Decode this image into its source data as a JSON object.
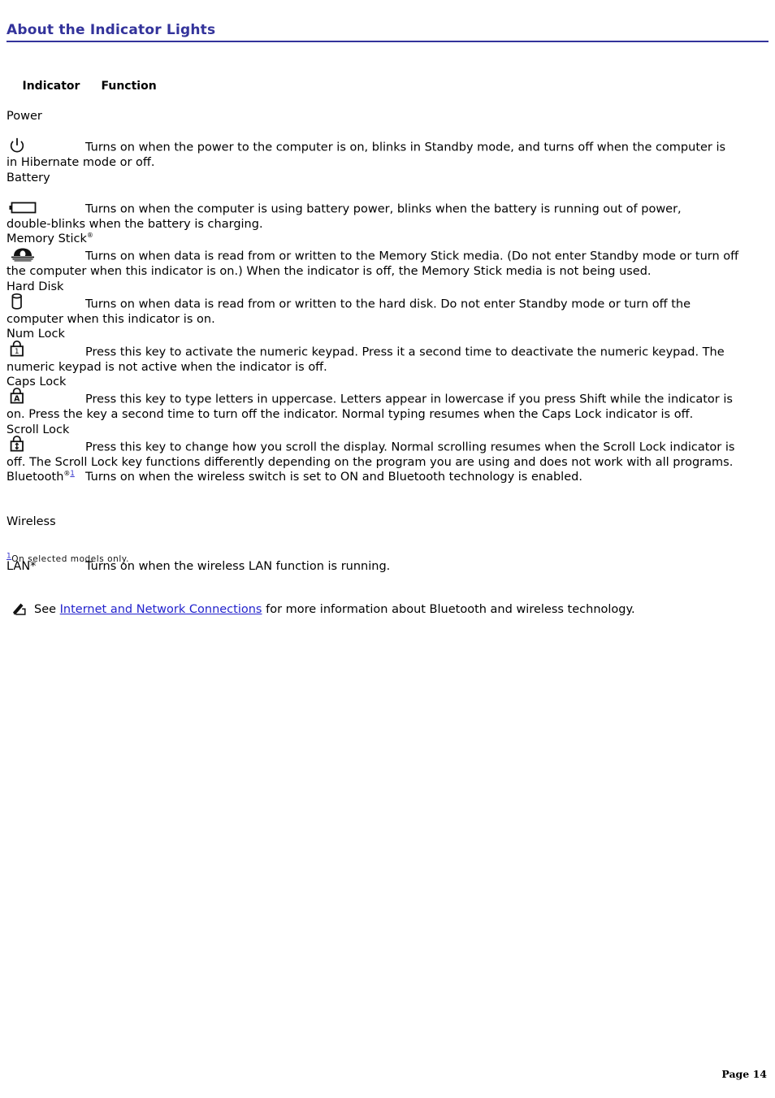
{
  "document": {
    "title": "About the Indicator Lights",
    "accent_color": "#33339B",
    "link_color": "#2222CC",
    "page_footer": "Page 14"
  },
  "table": {
    "headers": {
      "indicator": "Indicator",
      "function": "Function"
    },
    "rows": [
      {
        "label": "Power",
        "icon": "power-icon",
        "description_line1": "Turns on when the power to the computer is on, blinks in Standby mode, and turns off when the computer is",
        "description_line2": "in Hibernate mode or off."
      },
      {
        "label": "Battery",
        "icon": "battery-icon",
        "description_line1": "Turns on when the computer is using battery power, blinks when the battery is running out of power,",
        "description_line2": "double-blinks when the battery is charging."
      },
      {
        "label": "Memory Stick",
        "label_suffix": "®",
        "icon": "memory-stick-icon",
        "description_line1": "Turns on when data is read from or written to the Memory Stick media. (Do not enter Standby mode or turn off",
        "description_line2": "the computer when this indicator is on.) When the indicator is off, the Memory Stick media is not being used."
      },
      {
        "label": "Hard Disk",
        "icon": "hard-disk-icon",
        "description_line1": "Turns on when data is read from or written to the hard disk. Do not enter Standby mode or turn off the",
        "description_line2": "computer when this indicator is on."
      },
      {
        "label": "Num Lock",
        "icon": "num-lock-icon",
        "description_line1": "Press this key to activate the numeric keypad. Press it a second time to deactivate the numeric keypad. The",
        "description_line2": "numeric keypad is not active when the indicator is off."
      },
      {
        "label": "Caps Lock",
        "icon": "caps-lock-icon",
        "description_line1": "Press this key to type letters in uppercase. Letters appear in lowercase if you press Shift while the indicator is",
        "description_line2": "on. Press the key a second time to turn off the indicator. Normal typing resumes when the Caps Lock indicator is off."
      },
      {
        "label": "Scroll Lock",
        "icon": "scroll-lock-icon",
        "description_line1": "Press this key to change how you scroll the display. Normal scrolling resumes when the Scroll Lock indicator is",
        "description_line2": "off. The Scroll Lock key functions differently depending on the program you are using and does not work with all programs."
      }
    ],
    "inline_rows": [
      {
        "label": "Bluetooth",
        "registered_mark": "®",
        "footnote_ref": "1",
        "description": "Turns on when the wireless switch is set to ON and Bluetooth technology is enabled."
      },
      {
        "label_line1": "Wireless",
        "label_line2": "LAN*",
        "description": "Turns on when the wireless LAN function is running."
      }
    ]
  },
  "footnote": {
    "marker": "1",
    "text": "On selected models only."
  },
  "note": {
    "icon": "note-pencil-icon",
    "prefix": "See ",
    "link_text": "Internet and Network Connections",
    "suffix": " for more information about Bluetooth and wireless technology."
  }
}
